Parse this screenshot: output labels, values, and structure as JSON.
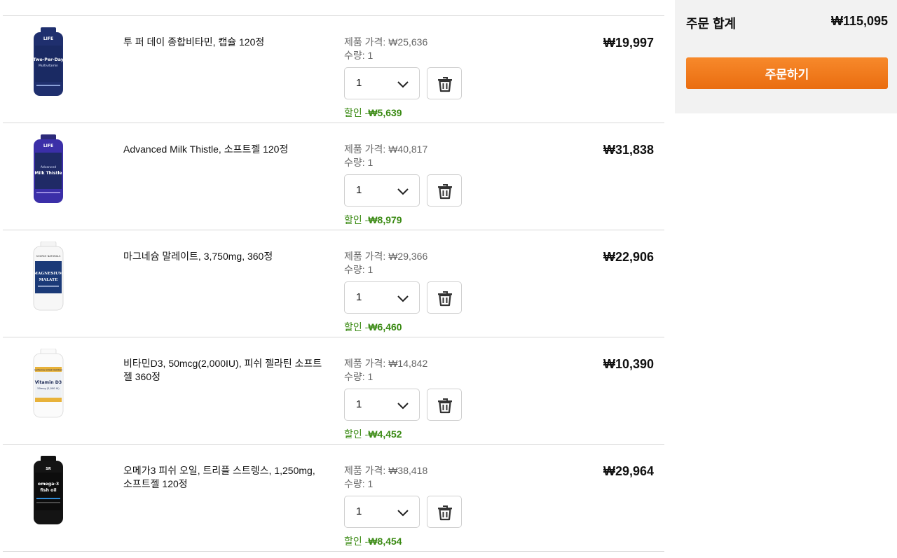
{
  "colors": {
    "discount": "#3a8a13",
    "accent": "#f47c20",
    "summary_bg": "#f2f2f2"
  },
  "items": [
    {
      "name": "투 퍼 데이 종합비타민, 캡슐 120정",
      "price_label": "제품 가격: ",
      "price": "₩25,636",
      "qty_label": "수량: 1",
      "qty_value": "1",
      "discount_label": "할인 -",
      "discount": "₩5,639",
      "total": "₩19,997",
      "image": {
        "brand": "LIFE",
        "line1": "Two-Per-Day",
        "line2": "Multivitamin"
      }
    },
    {
      "name": "Advanced Milk Thistle, 소프트젤 120정",
      "price_label": "제품 가격: ",
      "price": "₩40,817",
      "qty_label": "수량: 1",
      "qty_value": "1",
      "discount_label": "할인 -",
      "discount": "₩8,979",
      "total": "₩31,838",
      "image": {
        "brand": "LIFE",
        "line1": "Advanced",
        "line2": "Milk Thistle"
      }
    },
    {
      "name": "마그네슘 말레이트, 3,750mg, 360정",
      "price_label": "제품 가격: ",
      "price": "₩29,366",
      "qty_label": "수량: 1",
      "qty_value": "1",
      "discount_label": "할인 -",
      "discount": "₩6,460",
      "total": "₩22,906",
      "image": {
        "brand": "SOURCE NATURALS",
        "line1": "MAGNESIUM",
        "line2": "MALATE"
      }
    },
    {
      "name": "비타민D3, 50mcg(2,000IU), 피쉬 젤라틴 소프트젤 360정",
      "price_label": "제품 가격: ",
      "price": "₩14,842",
      "qty_label": "수량: 1",
      "qty_value": "1",
      "discount_label": "할인 -",
      "discount": "₩4,452",
      "total": "₩10,390",
      "image": {
        "brand": "California GOLD Nutrition",
        "line1": "Vitamin D3",
        "line2": "50mcg (2,000 IU)"
      }
    },
    {
      "name": "오메가3 피쉬 오일, 트리플 스트렝스, 1,250mg, 소프트젤 120정",
      "price_label": "제품 가격: ",
      "price": "₩38,418",
      "qty_label": "수량: 1",
      "qty_value": "1",
      "discount_label": "할인 -",
      "discount": "₩8,454",
      "total": "₩29,964",
      "image": {
        "brand": "SR",
        "line1": "omega-3",
        "line2": "fish oil"
      }
    }
  ],
  "summary": {
    "label": "주문 합계",
    "total": "₩115,095",
    "checkout_label": "주문하기"
  }
}
